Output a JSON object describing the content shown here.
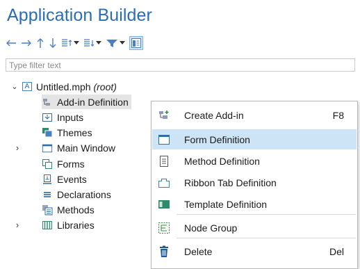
{
  "app": {
    "title": "Application Builder"
  },
  "toolbar": {
    "buttons": [
      {
        "name": "back-button",
        "icon": "arrow-left-icon"
      },
      {
        "name": "forward-button",
        "icon": "arrow-right-icon"
      },
      {
        "name": "move-up-button",
        "icon": "arrow-up-icon"
      },
      {
        "name": "move-down-button",
        "icon": "arrow-down-icon"
      },
      {
        "name": "expand-sections-button",
        "icon": "list-up-icon"
      },
      {
        "name": "collapse-sections-button",
        "icon": "list-down-icon"
      },
      {
        "name": "filter-button",
        "icon": "funnel-icon"
      },
      {
        "name": "show-panel-button",
        "icon": "panel-icon"
      }
    ]
  },
  "filter": {
    "placeholder": "Type filter text"
  },
  "tree": {
    "root_label": "Untitled.mph",
    "root_suffix": "(root)",
    "root_badge": "A",
    "items": [
      {
        "label": "Add-in Definition",
        "icon": "add-in-definition-icon"
      },
      {
        "label": "Inputs",
        "icon": "inputs-icon"
      },
      {
        "label": "Themes",
        "icon": "themes-icon"
      },
      {
        "label": "Main Window",
        "icon": "main-window-icon"
      },
      {
        "label": "Forms",
        "icon": "forms-icon"
      },
      {
        "label": "Events",
        "icon": "events-icon"
      },
      {
        "label": "Declarations",
        "icon": "declarations-icon"
      },
      {
        "label": "Methods",
        "icon": "methods-icon"
      },
      {
        "label": "Libraries",
        "icon": "libraries-icon"
      }
    ]
  },
  "context_menu": {
    "items": [
      {
        "label": "Create Add-in",
        "shortcut": "F8",
        "icon": "create-add-in-icon"
      },
      {
        "label": "Form Definition",
        "shortcut": "",
        "icon": "form-definition-icon",
        "highlighted": true
      },
      {
        "label": "Method Definition",
        "shortcut": "",
        "icon": "method-definition-icon"
      },
      {
        "label": "Ribbon Tab Definition",
        "shortcut": "",
        "icon": "ribbon-tab-icon"
      },
      {
        "label": "Template Definition",
        "shortcut": "",
        "icon": "template-definition-icon"
      },
      {
        "label": "Node Group",
        "shortcut": "",
        "icon": "node-group-icon"
      },
      {
        "label": "Delete",
        "shortcut": "Del",
        "icon": "delete-icon"
      }
    ]
  },
  "colors": {
    "title": "#2a6db3",
    "accent": "#4a7fc0",
    "menu_highlight": "#cde3f6",
    "tree_selection": "#e4e4e4"
  }
}
